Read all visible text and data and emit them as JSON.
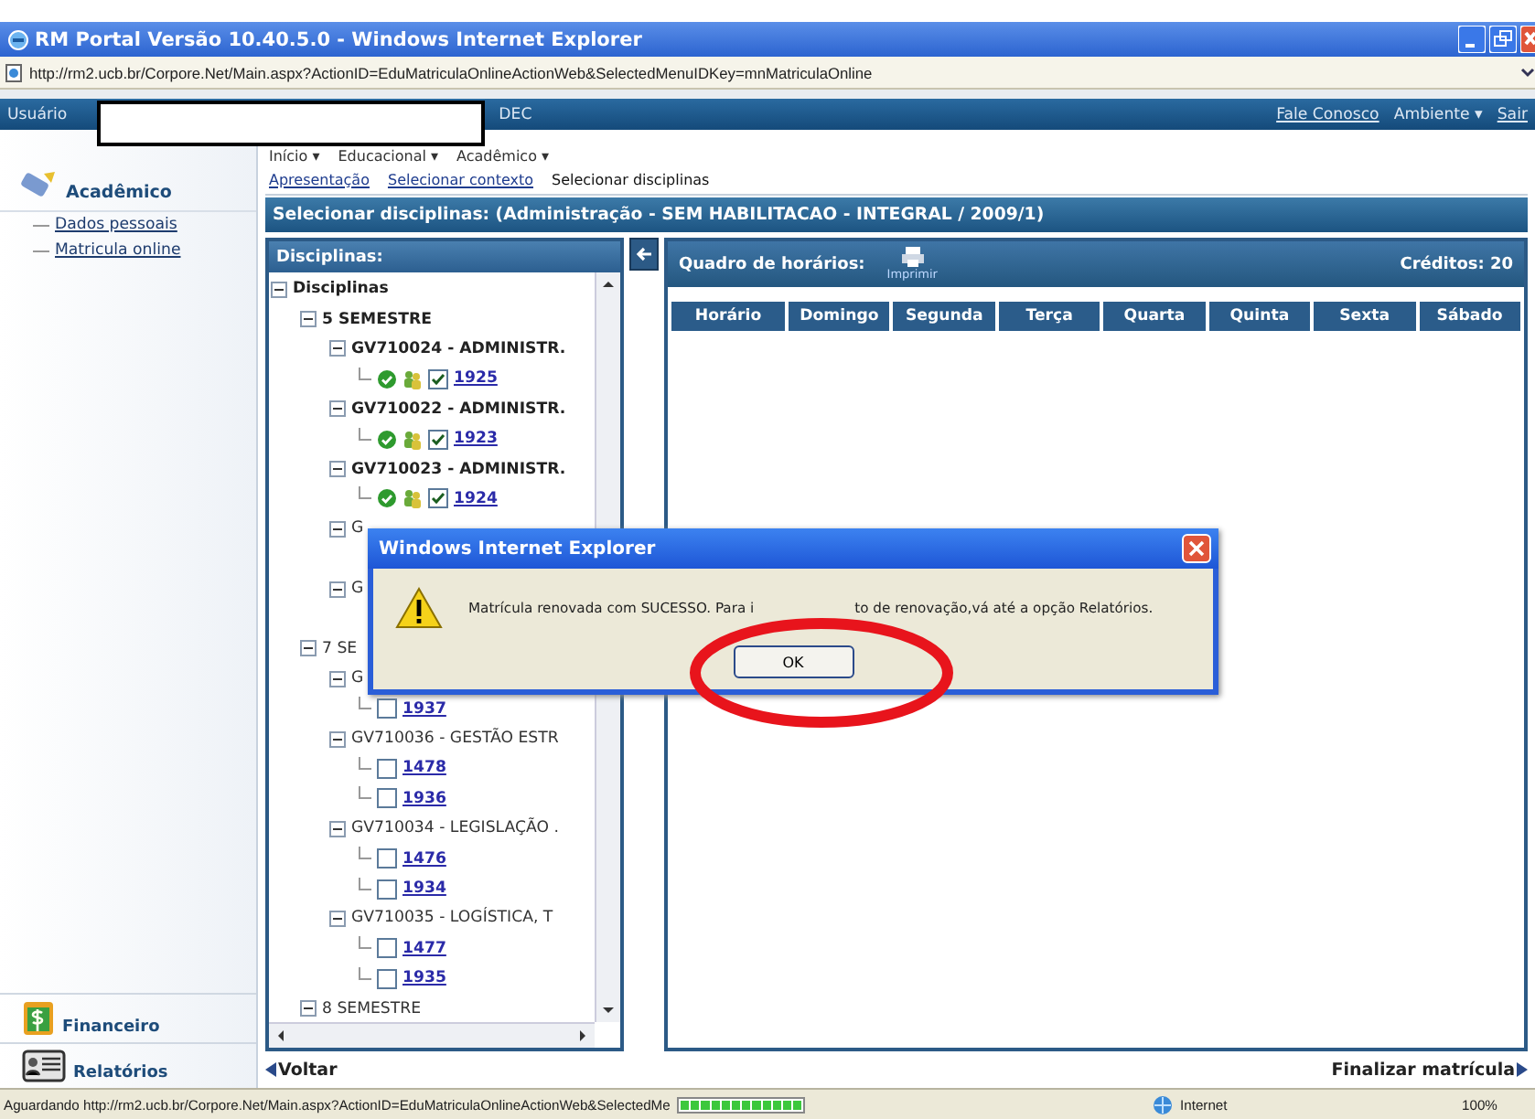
{
  "window": {
    "title": "RM Portal Versão 10.40.5.0 - Windows Internet Explorer"
  },
  "address_bar": {
    "url": "http://rm2.ucb.br/Corpore.Net/Main.aspx?ActionID=EduMatriculaOnlineActionWeb&SelectedMenuIDKey=mnMatriculaOnline"
  },
  "user_bar": {
    "label": "Usuário",
    "user_suffix": "DEC",
    "links": [
      {
        "label": "Fale Conosco",
        "kind": "link"
      },
      {
        "label": "Ambiente ▾",
        "kind": "menu"
      },
      {
        "label": "Sair",
        "kind": "link"
      }
    ]
  },
  "menu": [
    "Início ▾",
    "Educacional ▾",
    "Acadêmico ▾"
  ],
  "breadcrumb": [
    {
      "label": "Apresentação",
      "selected": false
    },
    {
      "label": "Selecionar contexto",
      "selected": false
    },
    {
      "label": "Selecionar disciplinas",
      "selected": true
    }
  ],
  "sidebar": {
    "section": "Acadêmico",
    "items": [
      "Dados pessoais",
      "Matricula online"
    ],
    "bottom": [
      {
        "label": "Financeiro",
        "kind": "money"
      },
      {
        "label": "Relatórios",
        "kind": "report"
      }
    ]
  },
  "heading": "Selecionar disciplinas: (Administração - SEM HABILITACAO - INTEGRAL / 2009/1)",
  "disciplinas": {
    "title": "Disciplinas:",
    "tree": [
      {
        "kind": "group",
        "label": "Disciplinas",
        "expanded": true,
        "children": [
          {
            "kind": "group",
            "label": "5 SEMESTRE",
            "expanded": true,
            "children": [
              {
                "kind": "group",
                "label": "GV710024 - ADMINISTR.",
                "expanded": true,
                "children": [
                  {
                    "kind": "offering",
                    "label": "1925",
                    "checked": true
                  }
                ]
              },
              {
                "kind": "group",
                "label": "GV710022 - ADMINISTR.",
                "expanded": true,
                "children": [
                  {
                    "kind": "offering",
                    "label": "1923",
                    "checked": true
                  }
                ]
              },
              {
                "kind": "group",
                "label": "GV710023 - ADMINISTR.",
                "expanded": true,
                "children": [
                  {
                    "kind": "offering",
                    "label": "1924",
                    "checked": true
                  }
                ]
              },
              {
                "kind": "group",
                "label": "G",
                "expanded": true
              },
              {
                "kind": "group",
                "label": "G",
                "expanded": true
              }
            ]
          },
          {
            "kind": "group",
            "label": "7 SE",
            "expanded": true,
            "children": [
              {
                "kind": "group",
                "label": "G",
                "expanded": true,
                "children": [
                  {
                    "kind": "offering",
                    "label": "1937",
                    "checked": false
                  }
                ]
              },
              {
                "kind": "group",
                "label": "GV710036 - GESTÃO ESTR",
                "expanded": true,
                "children": [
                  {
                    "kind": "offering",
                    "label": "1478",
                    "checked": false
                  },
                  {
                    "kind": "offering",
                    "label": "1936",
                    "checked": false
                  }
                ]
              },
              {
                "kind": "group",
                "label": "GV710034 - LEGISLAÇÃO .",
                "expanded": true,
                "children": [
                  {
                    "kind": "offering",
                    "label": "1476",
                    "checked": false
                  },
                  {
                    "kind": "offering",
                    "label": "1934",
                    "checked": false
                  }
                ]
              },
              {
                "kind": "group",
                "label": "GV710035 - LOGÍSTICA, T",
                "expanded": true,
                "children": [
                  {
                    "kind": "offering",
                    "label": "1477",
                    "checked": false
                  },
                  {
                    "kind": "offering",
                    "label": "1935",
                    "checked": false
                  }
                ]
              }
            ]
          },
          {
            "kind": "group",
            "label": "8 SEMESTRE",
            "expanded": true
          }
        ]
      }
    ]
  },
  "schedule": {
    "title": "Quadro de horários:",
    "print_label": "Imprimir",
    "credits": "Créditos: 20",
    "columns": [
      "Horário",
      "Domingo",
      "Segunda",
      "Terça",
      "Quarta",
      "Quinta",
      "Sexta",
      "Sábado"
    ]
  },
  "footer": {
    "back": "Voltar",
    "finish": "Finalizar matrícula"
  },
  "status_bar": {
    "text": "Aguardando http://rm2.ucb.br/Corpore.Net/Main.aspx?ActionID=EduMatriculaOnlineActionWeb&SelectedMe",
    "level": 1,
    "zone": "Internet",
    "zoom": "100%"
  },
  "dialog": {
    "title": "Windows Internet Explorer",
    "message_parts": [
      "Matrícula renovada com SUCESSO. Para i",
      "to de renovação,vá até a opção Relatórios."
    ],
    "button": "OK"
  }
}
